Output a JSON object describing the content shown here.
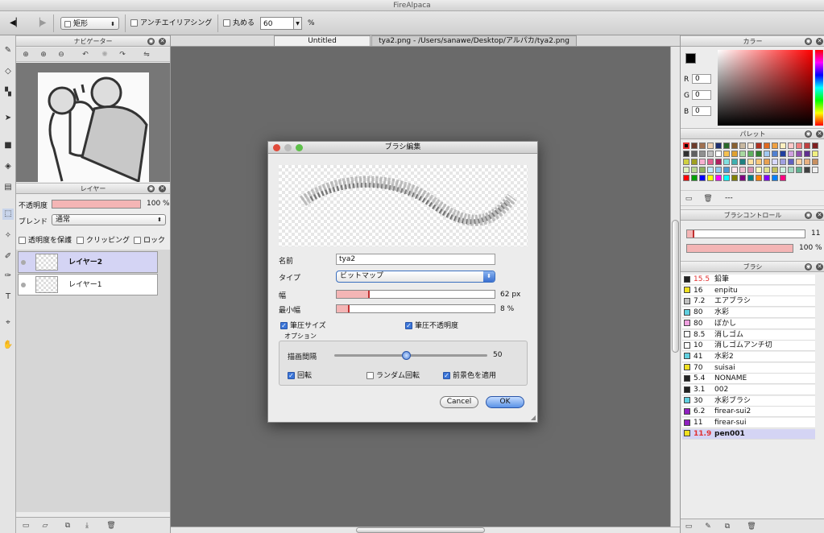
{
  "app": {
    "title": "FireAlpaca"
  },
  "toolbar": {
    "shape_select": "矩形",
    "antialias_label": "アンチエイリアシング",
    "round_label": "丸める",
    "round_value": "60",
    "percent_sign": "%"
  },
  "navigator": {
    "title": "ナビゲーター"
  },
  "layer_panel": {
    "title": "レイヤー",
    "opacity_label": "不透明度",
    "opacity_value": "100 %",
    "opacity_fraction": 1.0,
    "blend_label": "ブレンド",
    "blend_value": "通常",
    "protect_label": "透明度を保護",
    "clipping_label": "クリッピング",
    "lock_label": "ロック",
    "layers": [
      {
        "name": "レイヤー2",
        "selected": true
      },
      {
        "name": "レイヤー1",
        "selected": false
      }
    ]
  },
  "canvas_tab": {
    "untitled": "Untitled",
    "file": "tya2.png - /Users/sanawe/Desktop/アルパカ/tya2.png"
  },
  "dialog": {
    "title": "ブラシ編集",
    "name_label": "名前",
    "name_value": "tya2",
    "type_label": "タイプ",
    "type_value": "ビットマップ",
    "width_label": "幅",
    "width_value": "62 px",
    "width_fraction": 0.21,
    "minwidth_label": "最小幅",
    "minwidth_value": "8 %",
    "minwidth_fraction": 0.08,
    "pressure_size_label": "筆圧サイズ",
    "pressure_opacity_label": "筆圧不透明度",
    "options_label": "オプション",
    "spacing_label": "描画間隔",
    "spacing_value": "50",
    "spacing_fraction": 0.47,
    "rotate_label": "回転",
    "random_rotate_label": "ランダム回転",
    "fg_color_label": "前景色を適用",
    "cancel_label": "Cancel",
    "ok_label": "OK"
  },
  "color_panel": {
    "title": "カラー",
    "r_label": "R",
    "r_value": "0",
    "g_label": "G",
    "g_value": "0",
    "b_label": "B",
    "b_value": "0"
  },
  "palette_panel": {
    "title": "パレット",
    "dashes": "---",
    "colors": [
      "#000000",
      "#6b3b2a",
      "#a07050",
      "#f0d0b0",
      "#203070",
      "#2a6a2a",
      "#886030",
      "#c8b8a0",
      "#f4e8d8",
      "#b03020",
      "#e06a20",
      "#f0a040",
      "#fff0c0",
      "#ffc8c8",
      "#f08080",
      "#c04040",
      "#802020",
      "#303030",
      "#606060",
      "#909090",
      "#c0c0c0",
      "#ffffff",
      "#f4c050",
      "#e0a030",
      "#a8d8a0",
      "#60b060",
      "#308030",
      "#a0c8f0",
      "#5080d0",
      "#2040a0",
      "#d0a0e0",
      "#9050b0",
      "#603090",
      "#f0f080",
      "#d0d040",
      "#a0a020",
      "#f8b0d0",
      "#e06090",
      "#b02060",
      "#80e0e0",
      "#40b0b0",
      "#208080",
      "#ffe0a0",
      "#f8c878",
      "#e8a050",
      "#d8d8ff",
      "#a0a0e0",
      "#6060c0",
      "#ffd0a0",
      "#e8b080",
      "#c89060",
      "#e0f0c0",
      "#b8d890",
      "#90b060",
      "#c0e8ff",
      "#90c8f0",
      "#5098d0",
      "#ffe8f0",
      "#f0c0d0",
      "#d890b0",
      "#f8f8c0",
      "#e0e090",
      "#c0c060",
      "#d0f0e0",
      "#a0d8c0",
      "#60b090",
      "#404040",
      "#f0f0f0",
      "#ff0000",
      "#00a000",
      "#0000ff",
      "#ffff00",
      "#ff00ff",
      "#00ffff",
      "#808000",
      "#800080",
      "#008080",
      "#ff8000",
      "#8000ff",
      "#0080ff",
      "#ff0080"
    ]
  },
  "brush_control": {
    "title": "ブラシコントロール",
    "size_value": "11",
    "size_fraction": 0.06,
    "opacity_value": "100 %",
    "opacity_fraction": 1.0
  },
  "brush_panel": {
    "title": "ブラシ",
    "brushes": [
      {
        "size": "15.5",
        "name": "鉛筆",
        "color": "#222222",
        "size_color": "#e03030"
      },
      {
        "size": "16",
        "name": "enpitu",
        "color": "#f0e020",
        "size_color": "#111111"
      },
      {
        "size": "7.2",
        "name": "エアブラシ",
        "color": "#c0c0c0",
        "size_color": "#111111"
      },
      {
        "size": "80",
        "name": "水彩",
        "color": "#60d0e0",
        "size_color": "#111111"
      },
      {
        "size": "80",
        "name": "ぼかし",
        "color": "#f0a0e0",
        "size_color": "#111111"
      },
      {
        "size": "8.5",
        "name": "消しゴム",
        "color": "#ffffff",
        "size_color": "#111111"
      },
      {
        "size": "10",
        "name": "消しゴムアンチ切",
        "color": "#ffffff",
        "size_color": "#111111"
      },
      {
        "size": "41",
        "name": "水彩2",
        "color": "#60d0e0",
        "size_color": "#111111"
      },
      {
        "size": "70",
        "name": "suisai",
        "color": "#f0e020",
        "size_color": "#111111"
      },
      {
        "size": "5.4",
        "name": "NONAME",
        "color": "#222222",
        "size_color": "#111111"
      },
      {
        "size": "3.1",
        "name": "002",
        "color": "#222222",
        "size_color": "#111111"
      },
      {
        "size": "30",
        "name": "水彩ブラシ",
        "color": "#60d0e0",
        "size_color": "#111111"
      },
      {
        "size": "6.2",
        "name": "firear-sui2",
        "color": "#9020c0",
        "size_color": "#111111"
      },
      {
        "size": "11",
        "name": "firear-sui",
        "color": "#9020c0",
        "size_color": "#111111"
      },
      {
        "size": "11.9",
        "name": "pen001",
        "color": "#f0e020",
        "size_color": "#e03030",
        "selected": true
      }
    ]
  }
}
